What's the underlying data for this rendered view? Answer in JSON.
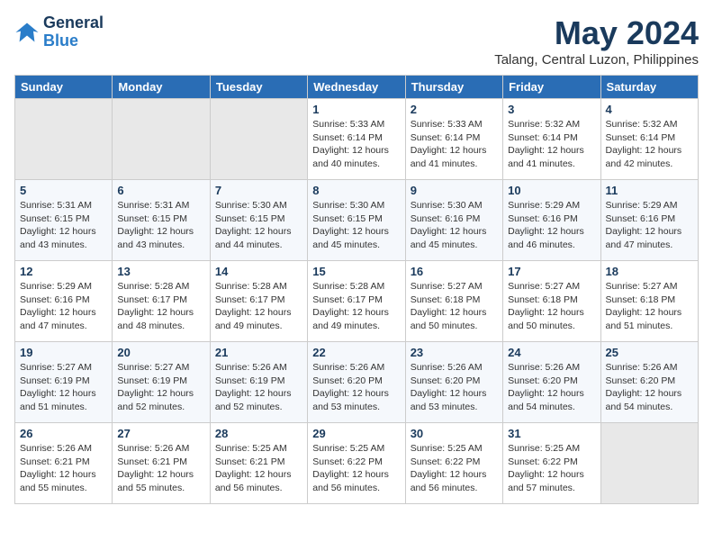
{
  "logo": {
    "line1": "General",
    "line2": "Blue"
  },
  "title": "May 2024",
  "location": "Talang, Central Luzon, Philippines",
  "headers": [
    "Sunday",
    "Monday",
    "Tuesday",
    "Wednesday",
    "Thursday",
    "Friday",
    "Saturday"
  ],
  "weeks": [
    [
      {
        "day": "",
        "info": ""
      },
      {
        "day": "",
        "info": ""
      },
      {
        "day": "",
        "info": ""
      },
      {
        "day": "1",
        "info": "Sunrise: 5:33 AM\nSunset: 6:14 PM\nDaylight: 12 hours\nand 40 minutes."
      },
      {
        "day": "2",
        "info": "Sunrise: 5:33 AM\nSunset: 6:14 PM\nDaylight: 12 hours\nand 41 minutes."
      },
      {
        "day": "3",
        "info": "Sunrise: 5:32 AM\nSunset: 6:14 PM\nDaylight: 12 hours\nand 41 minutes."
      },
      {
        "day": "4",
        "info": "Sunrise: 5:32 AM\nSunset: 6:14 PM\nDaylight: 12 hours\nand 42 minutes."
      }
    ],
    [
      {
        "day": "5",
        "info": "Sunrise: 5:31 AM\nSunset: 6:15 PM\nDaylight: 12 hours\nand 43 minutes."
      },
      {
        "day": "6",
        "info": "Sunrise: 5:31 AM\nSunset: 6:15 PM\nDaylight: 12 hours\nand 43 minutes."
      },
      {
        "day": "7",
        "info": "Sunrise: 5:30 AM\nSunset: 6:15 PM\nDaylight: 12 hours\nand 44 minutes."
      },
      {
        "day": "8",
        "info": "Sunrise: 5:30 AM\nSunset: 6:15 PM\nDaylight: 12 hours\nand 45 minutes."
      },
      {
        "day": "9",
        "info": "Sunrise: 5:30 AM\nSunset: 6:16 PM\nDaylight: 12 hours\nand 45 minutes."
      },
      {
        "day": "10",
        "info": "Sunrise: 5:29 AM\nSunset: 6:16 PM\nDaylight: 12 hours\nand 46 minutes."
      },
      {
        "day": "11",
        "info": "Sunrise: 5:29 AM\nSunset: 6:16 PM\nDaylight: 12 hours\nand 47 minutes."
      }
    ],
    [
      {
        "day": "12",
        "info": "Sunrise: 5:29 AM\nSunset: 6:16 PM\nDaylight: 12 hours\nand 47 minutes."
      },
      {
        "day": "13",
        "info": "Sunrise: 5:28 AM\nSunset: 6:17 PM\nDaylight: 12 hours\nand 48 minutes."
      },
      {
        "day": "14",
        "info": "Sunrise: 5:28 AM\nSunset: 6:17 PM\nDaylight: 12 hours\nand 49 minutes."
      },
      {
        "day": "15",
        "info": "Sunrise: 5:28 AM\nSunset: 6:17 PM\nDaylight: 12 hours\nand 49 minutes."
      },
      {
        "day": "16",
        "info": "Sunrise: 5:27 AM\nSunset: 6:18 PM\nDaylight: 12 hours\nand 50 minutes."
      },
      {
        "day": "17",
        "info": "Sunrise: 5:27 AM\nSunset: 6:18 PM\nDaylight: 12 hours\nand 50 minutes."
      },
      {
        "day": "18",
        "info": "Sunrise: 5:27 AM\nSunset: 6:18 PM\nDaylight: 12 hours\nand 51 minutes."
      }
    ],
    [
      {
        "day": "19",
        "info": "Sunrise: 5:27 AM\nSunset: 6:19 PM\nDaylight: 12 hours\nand 51 minutes."
      },
      {
        "day": "20",
        "info": "Sunrise: 5:27 AM\nSunset: 6:19 PM\nDaylight: 12 hours\nand 52 minutes."
      },
      {
        "day": "21",
        "info": "Sunrise: 5:26 AM\nSunset: 6:19 PM\nDaylight: 12 hours\nand 52 minutes."
      },
      {
        "day": "22",
        "info": "Sunrise: 5:26 AM\nSunset: 6:20 PM\nDaylight: 12 hours\nand 53 minutes."
      },
      {
        "day": "23",
        "info": "Sunrise: 5:26 AM\nSunset: 6:20 PM\nDaylight: 12 hours\nand 53 minutes."
      },
      {
        "day": "24",
        "info": "Sunrise: 5:26 AM\nSunset: 6:20 PM\nDaylight: 12 hours\nand 54 minutes."
      },
      {
        "day": "25",
        "info": "Sunrise: 5:26 AM\nSunset: 6:20 PM\nDaylight: 12 hours\nand 54 minutes."
      }
    ],
    [
      {
        "day": "26",
        "info": "Sunrise: 5:26 AM\nSunset: 6:21 PM\nDaylight: 12 hours\nand 55 minutes."
      },
      {
        "day": "27",
        "info": "Sunrise: 5:26 AM\nSunset: 6:21 PM\nDaylight: 12 hours\nand 55 minutes."
      },
      {
        "day": "28",
        "info": "Sunrise: 5:25 AM\nSunset: 6:21 PM\nDaylight: 12 hours\nand 56 minutes."
      },
      {
        "day": "29",
        "info": "Sunrise: 5:25 AM\nSunset: 6:22 PM\nDaylight: 12 hours\nand 56 minutes."
      },
      {
        "day": "30",
        "info": "Sunrise: 5:25 AM\nSunset: 6:22 PM\nDaylight: 12 hours\nand 56 minutes."
      },
      {
        "day": "31",
        "info": "Sunrise: 5:25 AM\nSunset: 6:22 PM\nDaylight: 12 hours\nand 57 minutes."
      },
      {
        "day": "",
        "info": ""
      }
    ]
  ]
}
